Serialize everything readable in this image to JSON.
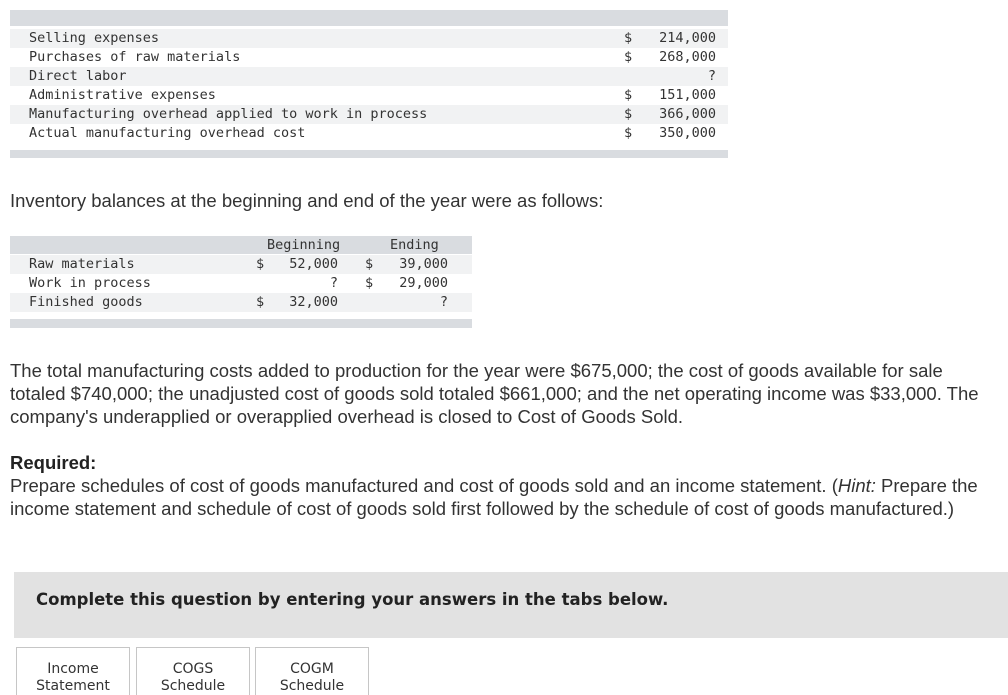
{
  "cost_table": {
    "rows": [
      {
        "label": "Selling expenses",
        "currency": "$",
        "amount": "214,000"
      },
      {
        "label": "Purchases of raw materials",
        "currency": "$",
        "amount": "268,000"
      },
      {
        "label": "Direct labor",
        "currency": "",
        "amount": "?"
      },
      {
        "label": "Administrative expenses",
        "currency": "$",
        "amount": "151,000"
      },
      {
        "label": "Manufacturing overhead applied to work in process",
        "currency": "$",
        "amount": "366,000"
      },
      {
        "label": "Actual manufacturing overhead cost",
        "currency": "$",
        "amount": "350,000"
      }
    ]
  },
  "inventory_intro": "Inventory balances at the beginning and end of the year were as follows:",
  "inventory_table": {
    "headers": {
      "beginning": "Beginning",
      "ending": "Ending"
    },
    "rows": [
      {
        "label": "Raw materials",
        "beg_cur": "$",
        "beg": "52,000",
        "end_cur": "$",
        "end": "39,000"
      },
      {
        "label": "Work in process",
        "beg_cur": "",
        "beg": "?",
        "end_cur": "$",
        "end": "29,000"
      },
      {
        "label": "Finished goods",
        "beg_cur": "$",
        "beg": "32,000",
        "end_cur": "",
        "end": "?"
      }
    ]
  },
  "totals_paragraph": "The total manufacturing costs added to production for the year were $675,000; the cost of goods available for sale totaled $740,000; the unadjusted cost of goods sold totaled $661,000; and the net operating income was $33,000. The company's underapplied or overapplied overhead is closed to Cost of Goods Sold.",
  "required": {
    "heading": "Required:",
    "text_before_hint": "Prepare schedules of cost of goods manufactured and cost of goods sold and an income statement. (",
    "hint_label": "Hint:",
    "text_after_hint": " Prepare the income statement and schedule of cost of goods sold first followed by the schedule of cost of goods manufactured.)"
  },
  "banner": "Complete this question by entering your answers in the tabs below.",
  "tabs": [
    {
      "line1": "Income",
      "line2": "Statement"
    },
    {
      "line1": "COGS",
      "line2": "Schedule"
    },
    {
      "line1": "COGM",
      "line2": "Schedule"
    }
  ],
  "colors": {
    "band": "#d9dce0",
    "row_shade": "#f1f2f3",
    "banner": "#e2e2e2",
    "text": "#333333"
  }
}
